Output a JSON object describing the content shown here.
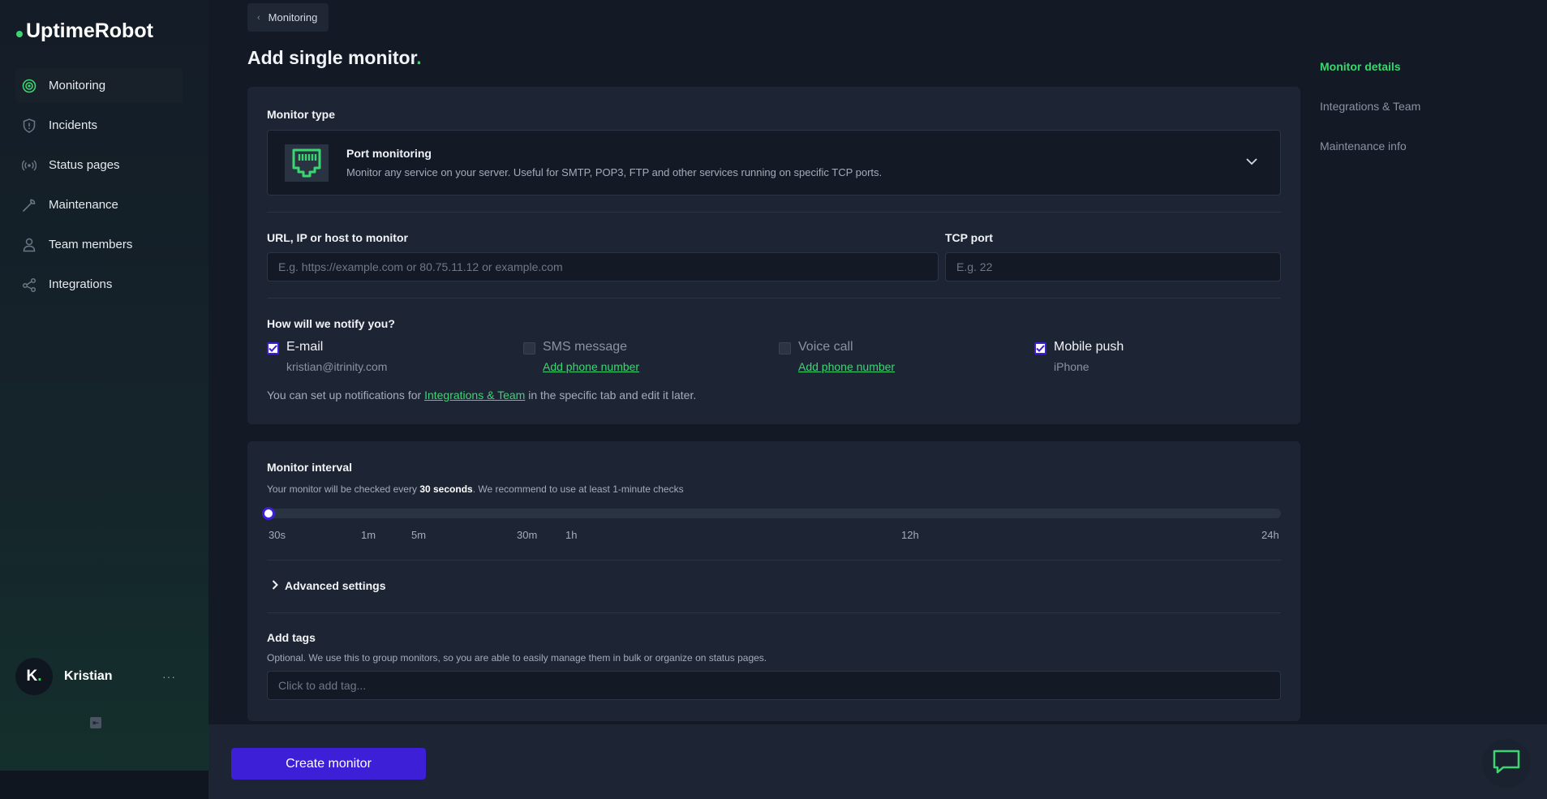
{
  "app": {
    "name": "UptimeRobot",
    "accent": "#3bd671",
    "primary": "#3c1fd6"
  },
  "sidebar": {
    "items": [
      {
        "label": "Monitoring",
        "icon": "monitoring-icon",
        "active": true
      },
      {
        "label": "Incidents",
        "icon": "shield-icon"
      },
      {
        "label": "Status pages",
        "icon": "broadcast-icon"
      },
      {
        "label": "Maintenance",
        "icon": "wrench-icon"
      },
      {
        "label": "Team members",
        "icon": "user-icon"
      },
      {
        "label": "Integrations",
        "icon": "share-icon"
      }
    ],
    "user": {
      "initial": "K",
      "name": "Kristian",
      "menu": "···"
    }
  },
  "breadcrumb": {
    "back_label": "Monitoring"
  },
  "page": {
    "title": "Add single monitor",
    "title_dot": "."
  },
  "monitor_type": {
    "label": "Monitor type",
    "selected_title": "Port monitoring",
    "selected_desc": "Monitor any service on your server. Useful for SMTP, POP3, FTP and other services running on specific TCP ports."
  },
  "url_field": {
    "label": "URL, IP or host to monitor",
    "placeholder": "E.g. https://example.com or 80.75.11.12 or example.com",
    "value": ""
  },
  "port_field": {
    "label": "TCP port",
    "placeholder": "E.g. 22",
    "value": ""
  },
  "notify": {
    "label": "How will we notify you?",
    "channels": [
      {
        "title": "E-mail",
        "sub": "kristian@itrinity.com",
        "checked": true
      },
      {
        "title": "SMS message",
        "link": "Add phone number",
        "checked": false
      },
      {
        "title": "Voice call",
        "link": "Add phone number",
        "checked": false
      },
      {
        "title": "Mobile push",
        "sub": "iPhone",
        "checked": true
      }
    ],
    "hint_before": "You can set up notifications for ",
    "hint_link": "Integrations & Team",
    "hint_after": " in the specific tab and edit it later."
  },
  "interval": {
    "label": "Monitor interval",
    "desc_before": "Your monitor will be checked every ",
    "desc_value": "30 seconds",
    "desc_after": ". We recommend to use at least 1-minute checks",
    "slider_value": 0,
    "ticks": [
      "30s",
      "1m",
      "5m",
      "30m",
      "1h",
      "12h",
      "24h"
    ]
  },
  "advanced": {
    "label": "Advanced settings"
  },
  "tags": {
    "label": "Add tags",
    "desc": "Optional. We use this to group monitors, so you are able to easily manage them in bulk or organize on status pages.",
    "placeholder": "Click to add tag..."
  },
  "side_nav": {
    "items": [
      {
        "label": "Monitor details",
        "active": true
      },
      {
        "label": "Integrations & Team"
      },
      {
        "label": "Maintenance info"
      }
    ]
  },
  "footer": {
    "create_label": "Create monitor"
  }
}
